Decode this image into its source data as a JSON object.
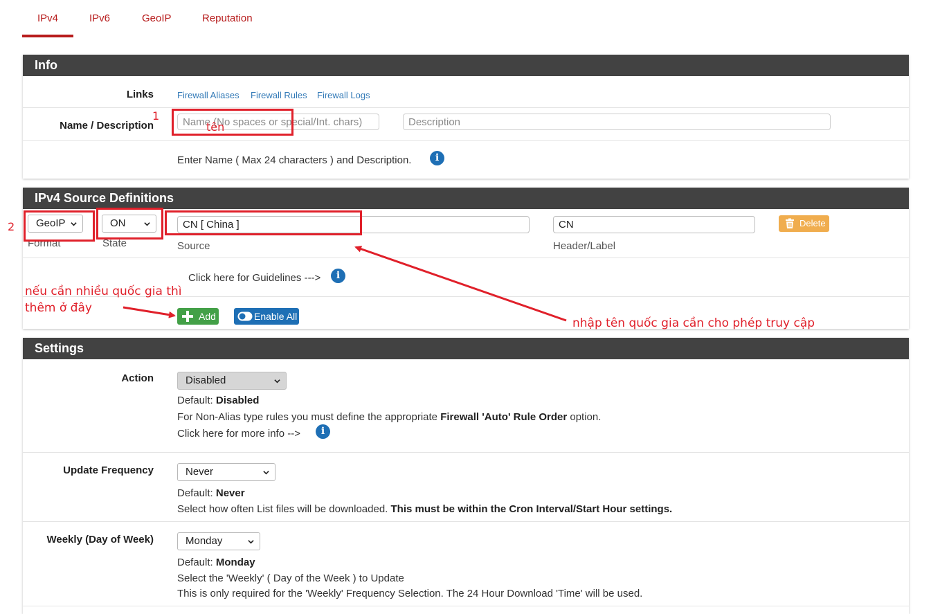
{
  "tabs": [
    {
      "label": "IPv4",
      "active": true
    },
    {
      "label": "IPv6"
    },
    {
      "label": "GeoIP"
    },
    {
      "label": "Reputation"
    }
  ],
  "info": {
    "title": "Info",
    "links_label": "Links",
    "links": [
      "Firewall Aliases",
      "Firewall Rules",
      "Firewall Logs"
    ],
    "name_desc_label": "Name / Description",
    "name_placeholder": "Name (No spaces or special/Int. chars)",
    "description_placeholder": "Description",
    "help": "Enter Name ( Max 24 characters ) and Description."
  },
  "source": {
    "title": "IPv4 Source Definitions",
    "format_value": "GeoIP",
    "format_label": "Format",
    "state_value": "ON",
    "state_label": "State",
    "source_value": "CN [ China ]",
    "source_label": "Source",
    "header_value": "CN",
    "header_label": "Header/Label",
    "delete_label": "Delete",
    "guidelines": "Click here for Guidelines --->",
    "add_label": "Add",
    "enable_all_label": "Enable All"
  },
  "settings": {
    "title": "Settings",
    "action": {
      "label": "Action",
      "value": "Disabled",
      "default_prefix": "Default: ",
      "default_value": "Disabled",
      "help_prefix": "For Non-Alias type rules you must define the appropriate ",
      "help_bold": "Firewall 'Auto' Rule Order",
      "help_suffix": " option.",
      "more_info": "Click here for more info -->"
    },
    "update_frequency": {
      "label": "Update Frequency",
      "value": "Never",
      "default_prefix": "Default: ",
      "default_value": "Never",
      "help_prefix": "Select how often List files will be downloaded. ",
      "help_bold": "This must be within the Cron Interval/Start Hour settings."
    },
    "weekly": {
      "label": "Weekly (Day of Week)",
      "value": "Monday",
      "default_prefix": "Default: ",
      "default_value": "Monday",
      "help_line1": "Select the 'Weekly' ( Day of the Week ) to Update",
      "help_line2": "This is only required for the 'Weekly' Frequency Selection. The 24 Hour Download 'Time' will be used."
    }
  },
  "annotations": {
    "num1": "1",
    "ten": "tên",
    "num2": "2",
    "add_note_line1": "nếu cần nhiều quốc gia thì",
    "add_note_line2": "thêm ở đây",
    "country_note": "nhập tên quốc gia cần cho phép truy cập",
    "color": "#e0202a"
  },
  "colors": {
    "brand_red": "#b71c1c",
    "panel_header": "#424242",
    "link_blue": "#337ab7",
    "add_green": "#43a047",
    "enable_blue": "#1e6fb5",
    "delete_orange": "#f0ad4e"
  }
}
